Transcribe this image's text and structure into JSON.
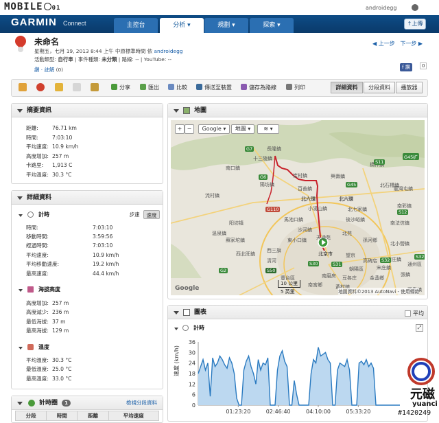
{
  "header": {
    "brand": "MOBILE",
    "brand_num": "01",
    "user": "androidegg",
    "garmin": "GARMIN",
    "connect": "Connect",
    "tabs": [
      "主控台",
      "分析",
      "規劃",
      "探索"
    ],
    "upload": "上傳"
  },
  "activity": {
    "title": "未命名",
    "line1": "星期五，七月 19, 2013 8:44 上午 中原標準時間 依",
    "line1_user": "androidegg",
    "line2_pre": "活動類型:",
    "activity_type": "自行車",
    "line2_mid": "| 事件種類:",
    "event_type": "未分類",
    "line2_post": "| 路線: -- | YouTube: --",
    "line3_link": "讚 · 註解",
    "line3_count": "(0)",
    "prev": "上一步",
    "next": "下一步",
    "like": "讚",
    "like_count": "0"
  },
  "toolbar": {
    "items": [
      "分享",
      "匯出",
      "比較",
      "傳送至裝置",
      "儲存為路線",
      "列印"
    ],
    "views": [
      "詳細資料",
      "分段資料",
      "播放器"
    ]
  },
  "summary": {
    "title": "摘要資訊",
    "rows": [
      {
        "k": "距離:",
        "v": "76.71 km"
      },
      {
        "k": "時間:",
        "v": "7:03:10"
      },
      {
        "k": "平均速度:",
        "v": "10.9 km/h"
      },
      {
        "k": "高度增加:",
        "v": "257 m"
      },
      {
        "k": "卡路里:",
        "v": "1,913 C"
      },
      {
        "k": "平均溫度:",
        "v": "30.3 °C"
      }
    ]
  },
  "details": {
    "title": "詳細資料",
    "timing": {
      "title": "計時",
      "toggle_pace": "步速",
      "toggle_speed": "速度",
      "rows": [
        {
          "k": "時間:",
          "v": "7:03:10"
        },
        {
          "k": "移動時間:",
          "v": "3:59:56"
        },
        {
          "k": "經過時間:",
          "v": "7:03:10"
        },
        {
          "k": "平均速度:",
          "v": "10.9 km/h"
        },
        {
          "k": "平均移動速度:",
          "v": "19.2 km/h"
        },
        {
          "k": "最高速度:",
          "v": "44.4 km/h"
        }
      ]
    },
    "elevation": {
      "title": "海拔高度",
      "rows": [
        {
          "k": "高度增加:",
          "v": "257 m"
        },
        {
          "k": "高度減少:",
          "v": "236 m"
        },
        {
          "k": "最低海拔:",
          "v": "37 m"
        },
        {
          "k": "最高海拔:",
          "v": "129 m"
        }
      ]
    },
    "temperature": {
      "title": "溫度",
      "rows": [
        {
          "k": "平均溫度:",
          "v": "30.3 °C"
        },
        {
          "k": "最低溫度:",
          "v": "25.0 °C"
        },
        {
          "k": "最高溫度:",
          "v": "33.0 °C"
        }
      ]
    }
  },
  "laps": {
    "title": "計時圈",
    "count": "1",
    "link": "檢視分段資料",
    "cols": [
      "分段",
      "時間",
      "距離",
      "平均速度"
    ]
  },
  "map": {
    "title": "地圖",
    "zoom_in": "+",
    "zoom_out": "−",
    "provider": "Google",
    "type": "地圖",
    "labels": [
      "長隆鎮",
      "十三陵鎮",
      "崔村鎮",
      "興壽鎮",
      "南口鎮",
      "陽坊鎮",
      "百善鎮",
      "流村鎮",
      "北六環",
      "小湯山鎮",
      "北七家鎮",
      "阳坊镇",
      "馬池口鎮",
      "沙河鎮",
      "北六環",
      "蘇家坨鎮",
      "西北旺鎮",
      "溫泉鎮",
      "東小口鎮",
      "天通苑",
      "西三旗",
      "清河",
      "北苑",
      "望京",
      "宋庄鎮",
      "北京市",
      "豐台區",
      "朝陽區",
      "橋梓鎮",
      "北石槽鎮",
      "南彩鎮",
      "後沙峪鎮",
      "孫河鄉",
      "南法信鎮",
      "北小營鎮",
      "龍灣屯鎮",
      "張鎮",
      "南宮鄉",
      "黃村鎮",
      "金盞鄉",
      "宋庄鎮",
      "通州區",
      "西集鎮",
      "高碑店",
      "豆各庄",
      "南磨房"
    ],
    "roads": [
      "G7",
      "S11",
      "G45",
      "G6",
      "G110",
      "S12",
      "S32",
      "S50",
      "G2",
      "S31",
      "G45扩",
      "S32",
      "S30"
    ],
    "scale_km": "10 公里",
    "scale_mi": "5 英里",
    "attribution": "地圖資料©2013 AutoNavi - 使用條款",
    "google": "Google"
  },
  "chart": {
    "title": "圖表",
    "avg_label": "平均",
    "section": "計時"
  },
  "chart_data": {
    "type": "area",
    "title": "",
    "xlabel": "",
    "ylabel": "速度 (km/h)",
    "ylim": [
      0,
      36
    ],
    "yticks": [
      0,
      6,
      12,
      18,
      24,
      30,
      36
    ],
    "xticks": [
      "01:23:20",
      "02:46:40",
      "04:10:00",
      "05:33:20"
    ],
    "series": [
      {
        "x_minutes": [
          0,
          5,
          10,
          15,
          20,
          25,
          30,
          35,
          40,
          45,
          50,
          55,
          60,
          65,
          70,
          75,
          80,
          85,
          90,
          95,
          100,
          105,
          110,
          115,
          120,
          125,
          130,
          135,
          140,
          145,
          150,
          155,
          160,
          165,
          170,
          175,
          180,
          185,
          190,
          195,
          200,
          205,
          210,
          215,
          220,
          225,
          230,
          235,
          240,
          245,
          250,
          255,
          260,
          265,
          270,
          275,
          280,
          285,
          290,
          295,
          300,
          305,
          310,
          315,
          320,
          325,
          330,
          335,
          340,
          345,
          350,
          355,
          360,
          365,
          370,
          375,
          380,
          385,
          390,
          395,
          400,
          405,
          410,
          415,
          420
        ],
        "values": [
          18,
          22,
          26,
          20,
          24,
          5,
          27,
          22,
          24,
          28,
          26,
          23,
          21,
          27,
          24,
          18,
          4,
          0,
          0,
          20,
          25,
          28,
          22,
          18,
          12,
          26,
          20,
          24,
          23,
          27,
          0,
          0,
          0,
          20,
          28,
          31,
          25,
          22,
          0,
          0,
          14,
          6,
          0,
          0,
          0,
          0,
          0,
          18,
          26,
          24,
          33,
          28,
          29,
          30,
          26,
          24,
          0,
          0,
          20,
          24,
          23,
          22,
          26,
          20,
          0,
          0,
          0,
          24,
          25,
          23,
          26,
          22,
          24,
          21,
          0,
          0,
          0,
          0,
          0,
          0,
          0,
          0,
          0,
          0,
          0
        ]
      }
    ]
  },
  "watermark": {
    "brand": "元磁",
    "sub": "yuanci",
    "id": "#1420249"
  },
  "colors": {
    "nav": "#0e4c86",
    "tab": "#2b6fb2",
    "route": "#c8202a",
    "chart_line": "#2a7ac0",
    "chart_fill": "#bcd8f0"
  }
}
